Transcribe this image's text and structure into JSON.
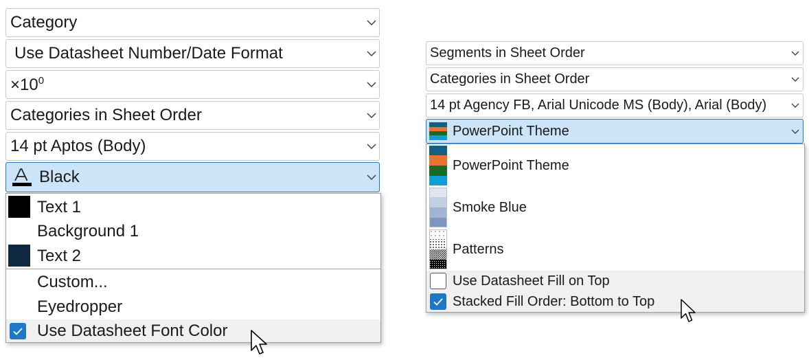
{
  "left": {
    "dropdowns": [
      {
        "label": "Category"
      },
      {
        "label": "Use Datasheet Number/Date Format"
      },
      {
        "label_base": "×10",
        "label_sup": "0"
      },
      {
        "label": "Categories in Sheet Order"
      },
      {
        "label": "14 pt Aptos (Body)"
      },
      {
        "label": "Black",
        "icon": "font-color-icon"
      }
    ],
    "menu": {
      "items": [
        {
          "label": "Text 1",
          "swatch": "#000000"
        },
        {
          "label": "Background 1",
          "swatch": "#ffffff"
        },
        {
          "label": "Text 2",
          "swatch": "#0e2841"
        },
        {
          "label": "Custom..."
        },
        {
          "label": "Eyedropper"
        },
        {
          "label": "Use Datasheet Font Color",
          "checked": true
        }
      ]
    }
  },
  "right": {
    "dropdowns": [
      {
        "label": "Segments in Sheet Order"
      },
      {
        "label": "Categories in Sheet Order"
      },
      {
        "label": "14 pt Agency FB, Arial Unicode MS (Body), Arial (Body)"
      },
      {
        "label": "PowerPoint Theme",
        "icon": "powerpoint-theme-swatch-icon"
      }
    ],
    "menu": {
      "items": [
        {
          "label": "PowerPoint Theme",
          "colors": [
            "#156082",
            "#e97132",
            "#196b24",
            "#0f9ed5"
          ]
        },
        {
          "label": "Smoke Blue",
          "colors": [
            "#dfe6ef",
            "#c3d0e2",
            "#a2b4d2",
            "#7e95c1"
          ]
        },
        {
          "label": "Patterns",
          "pattern": true
        },
        {
          "label": "Use Datasheet Fill on Top",
          "checked": false
        },
        {
          "label": "Stacked Fill Order: Bottom to Top",
          "checked": true
        }
      ]
    }
  },
  "colors": {
    "accent": "#1e78c8",
    "selected_bg": "#cce4f7",
    "hover_bg": "#f0f0f0"
  }
}
